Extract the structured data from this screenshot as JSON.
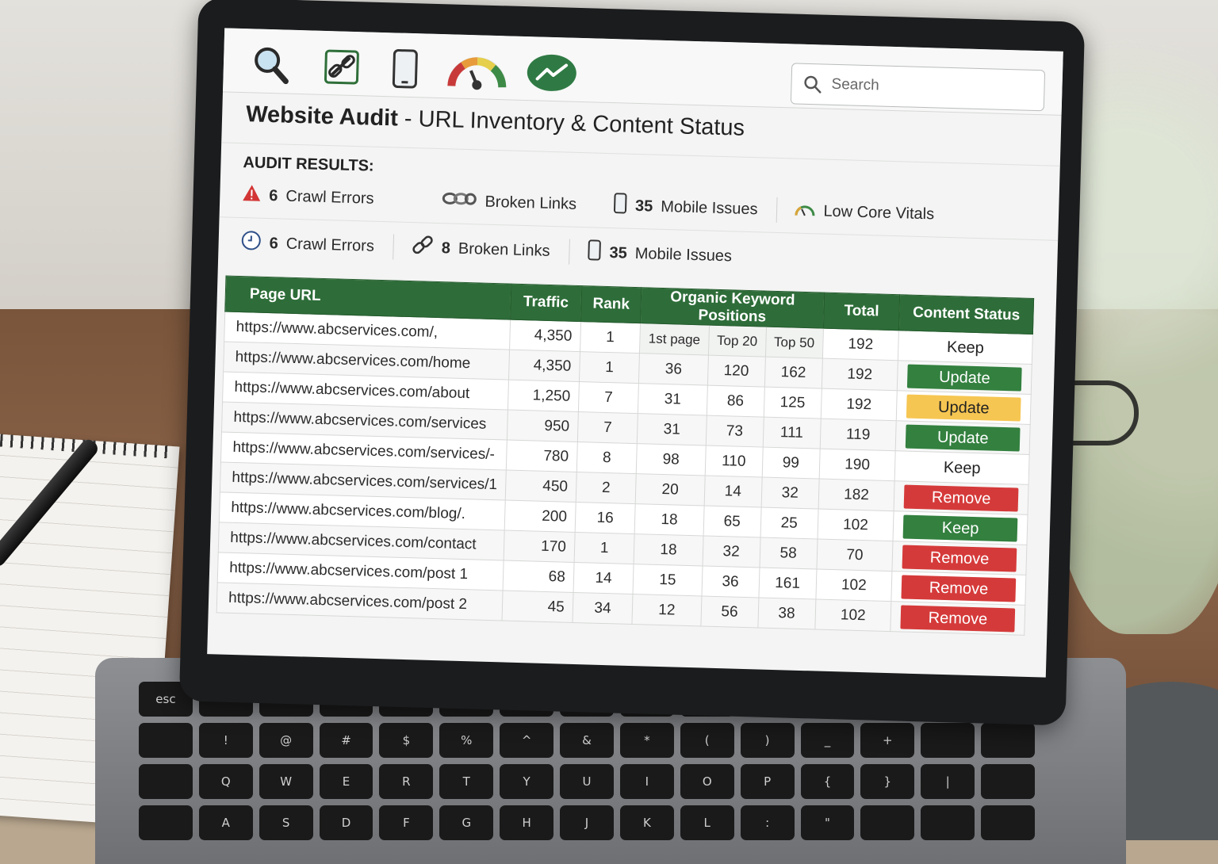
{
  "search": {
    "placeholder": "Search"
  },
  "page_title": {
    "bold": "Website Audit",
    "rest": " - URL Inventory & Content Status"
  },
  "audit": {
    "heading": "AUDIT RESULTS:",
    "row1": [
      {
        "icon": "warning-icon",
        "number": "6",
        "label": "Crawl Errors"
      },
      {
        "icon": "broken-link-icon",
        "number": "",
        "label": "Broken Links"
      },
      {
        "icon": "mobile-icon",
        "number": "35",
        "label": "Mobile Issues"
      },
      {
        "icon": "gauge-icon",
        "number": "",
        "label": "Low Core Vitals"
      }
    ],
    "row2": [
      {
        "icon": "clock-icon",
        "number": "6",
        "label": "Crawl Errors"
      },
      {
        "icon": "link-icon",
        "number": "8",
        "label": "Broken Links"
      },
      {
        "icon": "mobile-icon",
        "number": "35",
        "label": "Mobile Issues"
      }
    ]
  },
  "table": {
    "headers": {
      "url": "Page URL",
      "traffic": "Traffic",
      "rank": "Rank",
      "positions": "Organic Keyword Positions",
      "total": "Total",
      "status": "Content Status"
    },
    "subheaders": {
      "first": "1st page",
      "top20": "Top 20",
      "top50": "Top 50"
    },
    "rows": [
      {
        "url": "https://www.abcservices.com/,",
        "traffic": "4,350",
        "rank": "1",
        "first": "",
        "top20": "",
        "top50": "",
        "total": "192",
        "status": "Keep",
        "style": "plain"
      },
      {
        "url": "https://www.abcservices.com/home",
        "traffic": "4,350",
        "rank": "1",
        "first": "36",
        "top20": "120",
        "top50": "162",
        "total": "192",
        "status": "Update",
        "style": "green"
      },
      {
        "url": "https://www.abcservices.com/about",
        "traffic": "1,250",
        "rank": "7",
        "first": "31",
        "top20": "86",
        "top50": "125",
        "total": "192",
        "status": "Update",
        "style": "yellow"
      },
      {
        "url": "https://www.abcservices.com/services",
        "traffic": "950",
        "rank": "7",
        "first": "31",
        "top20": "73",
        "top50": "111",
        "total": "119",
        "status": "Update",
        "style": "green"
      },
      {
        "url": "https://www.abcservices.com/services/-",
        "traffic": "780",
        "rank": "8",
        "first": "98",
        "top20": "110",
        "top50": "99",
        "total": "190",
        "status": "Keep",
        "style": "plain"
      },
      {
        "url": "https://www.abcservices.com/services/1",
        "traffic": "450",
        "rank": "2",
        "first": "20",
        "top20": "14",
        "top50": "32",
        "total": "182",
        "status": "Remove",
        "style": "red"
      },
      {
        "url": "https://www.abcservices.com/blog/.",
        "traffic": "200",
        "rank": "16",
        "first": "18",
        "top20": "65",
        "top50": "25",
        "total": "102",
        "status": "Keep",
        "style": "green"
      },
      {
        "url": "https://www.abcservices.com/contact",
        "traffic": "170",
        "rank": "1",
        "first": "18",
        "top20": "32",
        "top50": "58",
        "total": "70",
        "status": "Remove",
        "style": "red"
      },
      {
        "url": "https://www.abcservices.com/post 1",
        "traffic": "68",
        "rank": "14",
        "first": "15",
        "top20": "36",
        "top50": "161",
        "total": "102",
        "status": "Remove",
        "style": "red"
      },
      {
        "url": "https://www.abcservices.com/post 2",
        "traffic": "45",
        "rank": "34",
        "first": "12",
        "top20": "56",
        "top50": "38",
        "total": "102",
        "status": "Remove",
        "style": "red"
      }
    ]
  },
  "colors": {
    "header_green": "#2e6d39",
    "update_green": "#33803f",
    "update_yellow": "#f6c652",
    "remove_red": "#d53a3a"
  },
  "keyboard": {
    "row1": [
      "esc",
      "",
      "",
      "",
      "",
      "",
      "",
      "",
      "",
      "",
      "",
      "",
      "",
      "",
      ""
    ],
    "row2": [
      "",
      "!",
      "@",
      "#",
      "$",
      "%",
      "^",
      "&",
      "*",
      "(",
      ")",
      "_",
      "+",
      "",
      ""
    ],
    "row3": [
      "",
      "Q",
      "W",
      "E",
      "R",
      "T",
      "Y",
      "U",
      "I",
      "O",
      "P",
      "{",
      "}",
      "|",
      ""
    ],
    "row4": [
      "",
      "A",
      "S",
      "D",
      "F",
      "G",
      "H",
      "J",
      "K",
      "L",
      ":",
      "\"",
      "",
      "",
      ""
    ]
  }
}
